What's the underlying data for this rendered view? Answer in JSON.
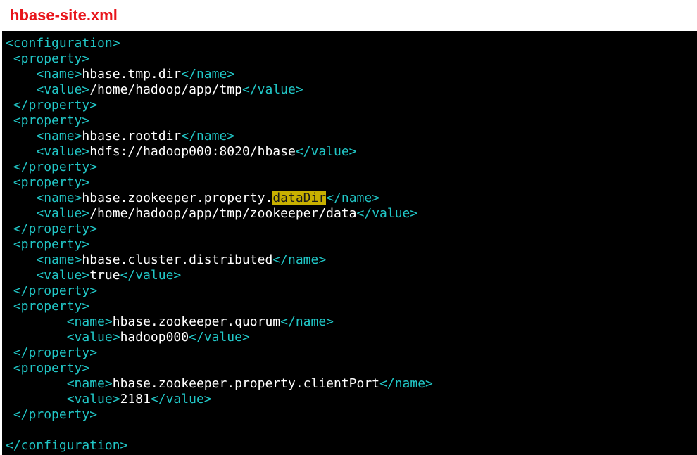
{
  "file_title": "hbase-site.xml",
  "colors": {
    "title": "#e8151b",
    "terminal_bg": "#000000",
    "tag": "#21c6c6",
    "text": "#ffffff",
    "highlight_bg": "#c8b000",
    "highlight_fg": "#1a1a1a"
  },
  "lines": [
    [
      {
        "t": "tag",
        "v": "<configuration>"
      }
    ],
    [
      {
        "t": "txt",
        "v": " "
      },
      {
        "t": "tag",
        "v": "<property>"
      }
    ],
    [
      {
        "t": "txt",
        "v": "    "
      },
      {
        "t": "tag",
        "v": "<name>"
      },
      {
        "t": "txt",
        "v": "hbase.tmp.dir"
      },
      {
        "t": "tag",
        "v": "</name>"
      }
    ],
    [
      {
        "t": "txt",
        "v": "    "
      },
      {
        "t": "tag",
        "v": "<value>"
      },
      {
        "t": "txt",
        "v": "/home/hadoop/app/tmp"
      },
      {
        "t": "tag",
        "v": "</value>"
      }
    ],
    [
      {
        "t": "txt",
        "v": " "
      },
      {
        "t": "tag",
        "v": "</property>"
      }
    ],
    [
      {
        "t": "txt",
        "v": " "
      },
      {
        "t": "tag",
        "v": "<property>"
      }
    ],
    [
      {
        "t": "txt",
        "v": "    "
      },
      {
        "t": "tag",
        "v": "<name>"
      },
      {
        "t": "txt",
        "v": "hbase.rootdir"
      },
      {
        "t": "tag",
        "v": "</name>"
      }
    ],
    [
      {
        "t": "txt",
        "v": "    "
      },
      {
        "t": "tag",
        "v": "<value>"
      },
      {
        "t": "txt",
        "v": "hdfs://hadoop000:8020/hbase"
      },
      {
        "t": "tag",
        "v": "</value>"
      }
    ],
    [
      {
        "t": "txt",
        "v": " "
      },
      {
        "t": "tag",
        "v": "</property>"
      }
    ],
    [
      {
        "t": "txt",
        "v": " "
      },
      {
        "t": "tag",
        "v": "<property>"
      }
    ],
    [
      {
        "t": "txt",
        "v": "    "
      },
      {
        "t": "tag",
        "v": "<name>"
      },
      {
        "t": "txt",
        "v": "hbase.zookeeper.property."
      },
      {
        "t": "hl",
        "v": "dataDir"
      },
      {
        "t": "tag",
        "v": "</name>"
      }
    ],
    [
      {
        "t": "txt",
        "v": "    "
      },
      {
        "t": "tag",
        "v": "<value>"
      },
      {
        "t": "txt",
        "v": "/home/hadoop/app/tmp/zookeeper/data"
      },
      {
        "t": "tag",
        "v": "</value>"
      }
    ],
    [
      {
        "t": "txt",
        "v": " "
      },
      {
        "t": "tag",
        "v": "</property>"
      }
    ],
    [
      {
        "t": "txt",
        "v": " "
      },
      {
        "t": "tag",
        "v": "<property>"
      }
    ],
    [
      {
        "t": "txt",
        "v": "    "
      },
      {
        "t": "tag",
        "v": "<name>"
      },
      {
        "t": "txt",
        "v": "hbase.cluster.distributed"
      },
      {
        "t": "tag",
        "v": "</name>"
      }
    ],
    [
      {
        "t": "txt",
        "v": "    "
      },
      {
        "t": "tag",
        "v": "<value>"
      },
      {
        "t": "txt",
        "v": "true"
      },
      {
        "t": "tag",
        "v": "</value>"
      }
    ],
    [
      {
        "t": "txt",
        "v": " "
      },
      {
        "t": "tag",
        "v": "</property>"
      }
    ],
    [
      {
        "t": "txt",
        "v": " "
      },
      {
        "t": "tag",
        "v": "<property>"
      }
    ],
    [
      {
        "t": "txt",
        "v": "        "
      },
      {
        "t": "tag",
        "v": "<name>"
      },
      {
        "t": "txt",
        "v": "hbase.zookeeper.quorum"
      },
      {
        "t": "tag",
        "v": "</name>"
      }
    ],
    [
      {
        "t": "txt",
        "v": "        "
      },
      {
        "t": "tag",
        "v": "<value>"
      },
      {
        "t": "txt",
        "v": "hadoop000"
      },
      {
        "t": "tag",
        "v": "</value>"
      }
    ],
    [
      {
        "t": "txt",
        "v": " "
      },
      {
        "t": "tag",
        "v": "</property>"
      }
    ],
    [
      {
        "t": "txt",
        "v": " "
      },
      {
        "t": "tag",
        "v": "<property>"
      }
    ],
    [
      {
        "t": "txt",
        "v": "        "
      },
      {
        "t": "tag",
        "v": "<name>"
      },
      {
        "t": "txt",
        "v": "hbase.zookeeper.property.clientPort"
      },
      {
        "t": "tag",
        "v": "</name>"
      }
    ],
    [
      {
        "t": "txt",
        "v": "        "
      },
      {
        "t": "tag",
        "v": "<value>"
      },
      {
        "t": "txt",
        "v": "2181"
      },
      {
        "t": "tag",
        "v": "</value>"
      }
    ],
    [
      {
        "t": "txt",
        "v": " "
      },
      {
        "t": "tag",
        "v": "</property>"
      }
    ],
    [],
    [
      {
        "t": "tag",
        "v": "</configuration>"
      }
    ]
  ]
}
